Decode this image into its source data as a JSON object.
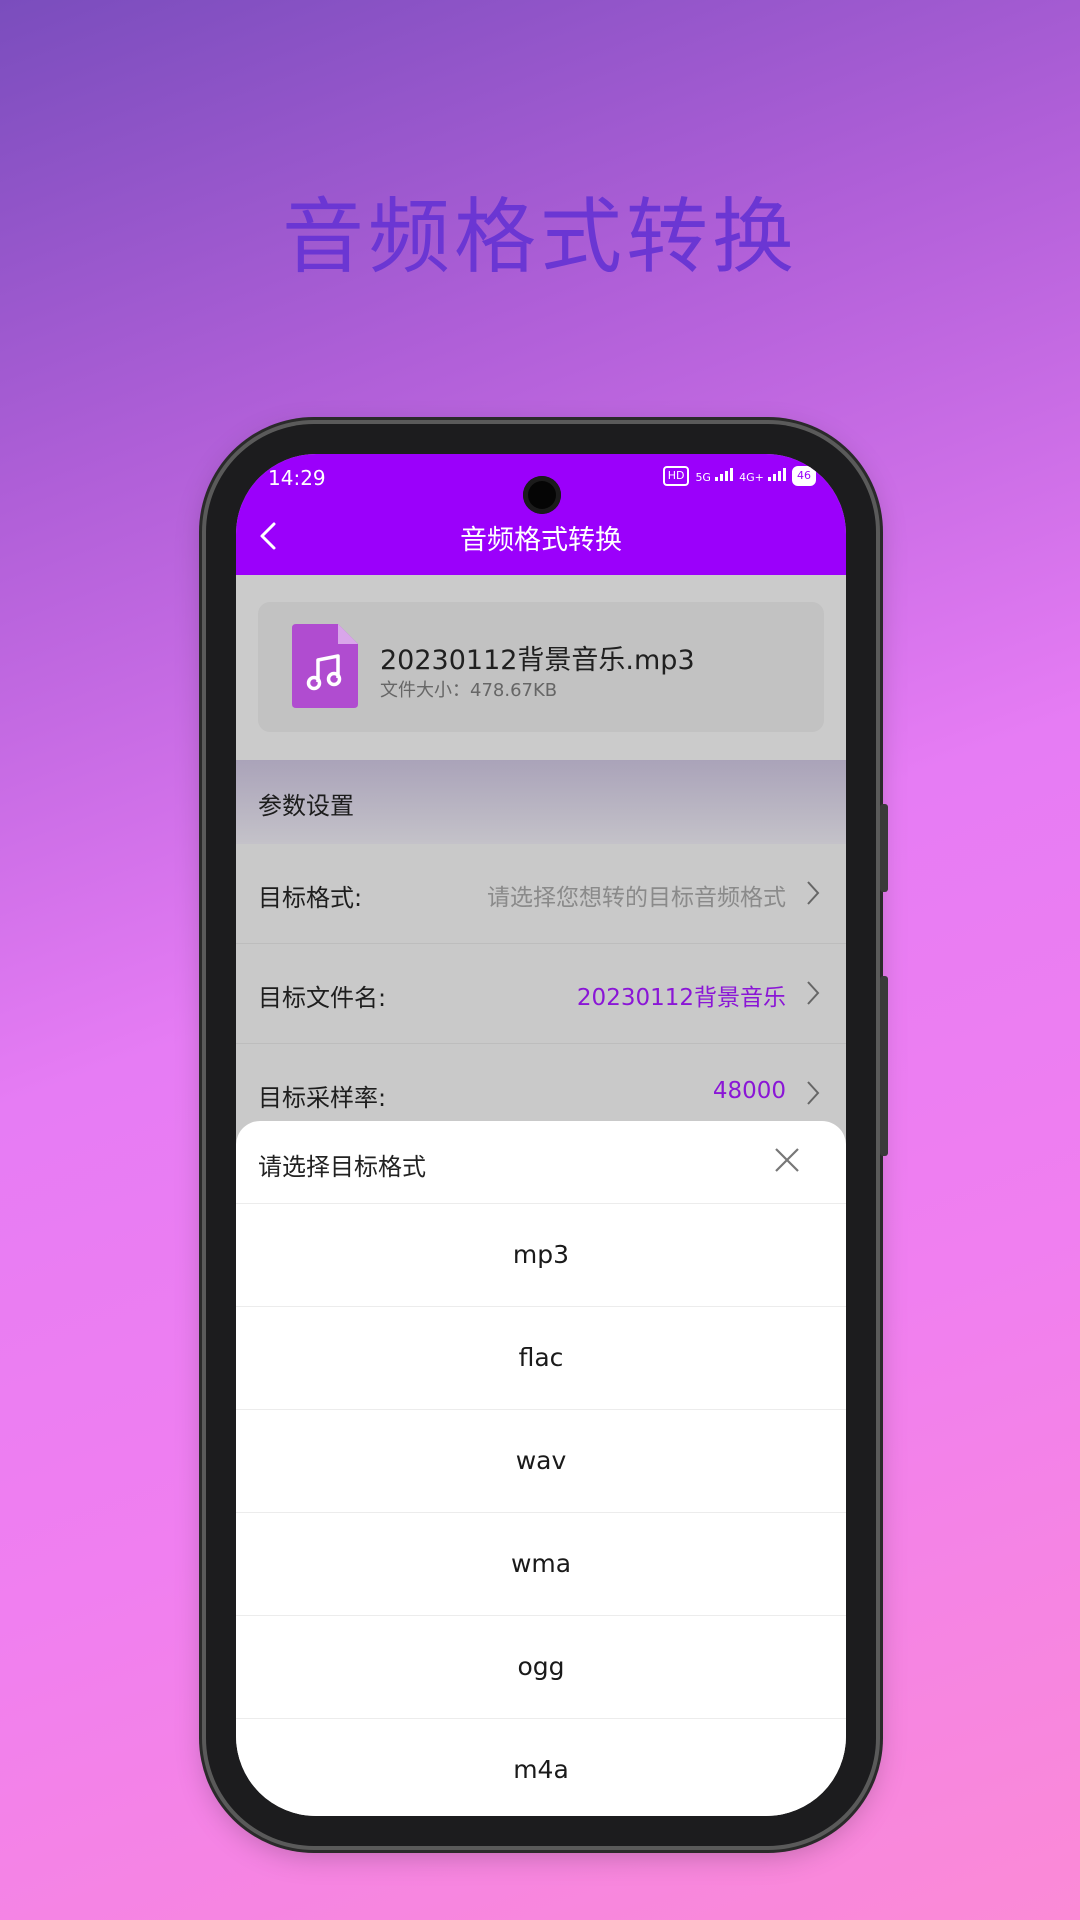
{
  "promo": {
    "title": "音频格式转换"
  },
  "status_bar": {
    "time": "14:29",
    "icons": [
      "HD",
      "5G",
      "4G+"
    ],
    "battery": "46"
  },
  "nav": {
    "title": "音频格式转换"
  },
  "file": {
    "name": "20230112背景音乐.mp3",
    "size": "文件大小：478.67KB",
    "icon": "music-file-icon"
  },
  "params": {
    "section_title": "参数设置",
    "rows": [
      {
        "label": "目标格式:",
        "value": "请选择您想转的目标音频格式"
      },
      {
        "label": "目标文件名:",
        "value": "20230112背景音乐"
      },
      {
        "label": "目标采样率:",
        "value": "48000"
      }
    ]
  },
  "sheet": {
    "title": "请选择目标格式",
    "options": [
      "mp3",
      "flac",
      "wav",
      "wma",
      "ogg",
      "m4a"
    ]
  },
  "colors": {
    "accent": "#9b00fb",
    "promo_title": "#6b36d3",
    "value_purple": "#8a16d6",
    "placeholder": "#8a8a8a"
  }
}
